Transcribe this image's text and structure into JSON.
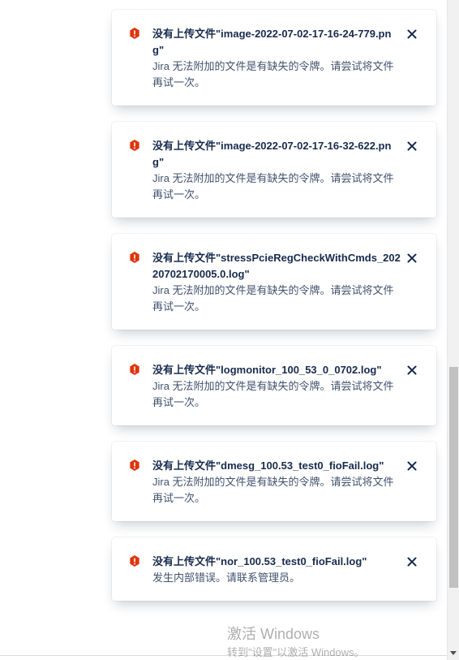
{
  "flags": [
    {
      "title": "没有上传文件\"image-2022-07-02-17-16-24-779.png\"",
      "body": "Jira 无法附加的文件是有缺失的令牌。请尝试将文件再试一次。"
    },
    {
      "title": "没有上传文件\"image-2022-07-02-17-16-32-622.png\"",
      "body": "Jira 无法附加的文件是有缺失的令牌。请尝试将文件再试一次。"
    },
    {
      "title": "没有上传文件\"stressPcieRegCheckWithCmds_20220702170005.0.log\"",
      "body": "Jira 无法附加的文件是有缺失的令牌。请尝试将文件再试一次。"
    },
    {
      "title": "没有上传文件\"logmonitor_100_53_0_0702.log\"",
      "body": "Jira 无法附加的文件是有缺失的令牌。请尝试将文件再试一次。"
    },
    {
      "title": "没有上传文件\"dmesg_100.53_test0_fioFail.log\"",
      "body": "Jira 无法附加的文件是有缺失的令牌。请尝试将文件再试一次。"
    },
    {
      "title": "没有上传文件\"nor_100.53_test0_fioFail.log\"",
      "body": "发生内部错误。请联系管理员。"
    }
  ],
  "icons": {
    "error": "error-icon",
    "close": "close-icon"
  },
  "colors": {
    "error": "#DE350B",
    "title": "#172B4D",
    "body": "#42526E"
  },
  "watermark": {
    "line1": "激活 Windows",
    "line2": "转到\"设置\"以激活 Windows。"
  }
}
